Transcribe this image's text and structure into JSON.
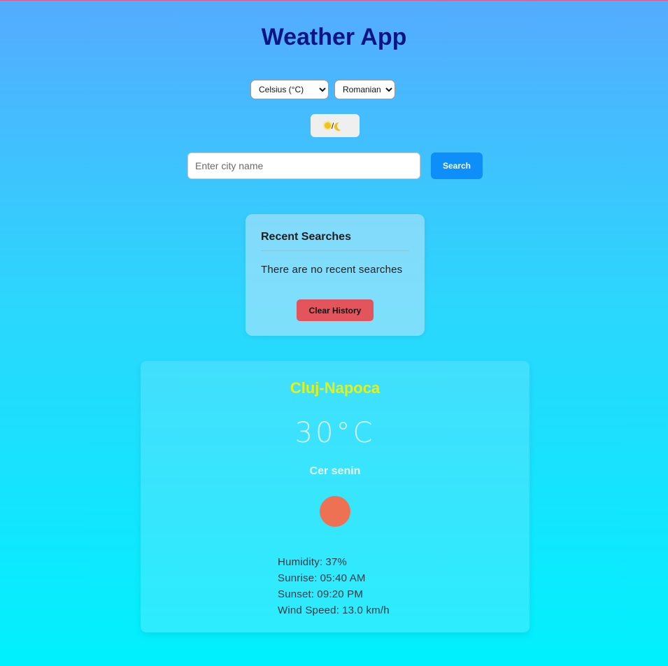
{
  "app": {
    "title": "Weather App"
  },
  "controls": {
    "unit_select": {
      "selected": "Celsius (°C)"
    },
    "language_select": {
      "selected": "Romanian"
    },
    "theme_toggle": {
      "separator": "/",
      "icons": [
        "sun-icon",
        "moon-icon"
      ]
    }
  },
  "search": {
    "placeholder": "Enter city name",
    "value": "",
    "button_label": "Search"
  },
  "recent_searches": {
    "title": "Recent Searches",
    "empty_message": "There are no recent searches",
    "clear_button_label": "Clear History"
  },
  "weather": {
    "city": "Cluj-Napoca",
    "temperature": "30°C",
    "description": "Cer senin",
    "icon": "weather-condition-icon",
    "details": [
      {
        "label": "Humidity:",
        "value": "37%"
      },
      {
        "label": "Sunrise:",
        "value": "05:40 AM"
      },
      {
        "label": "Sunset:",
        "value": "09:20 PM"
      },
      {
        "label": "Wind Speed:",
        "value": "13.0 km/h"
      }
    ]
  },
  "colors": {
    "title": "#0d1585",
    "city": "#e8f10a",
    "search_button": "#0d8ef8",
    "clear_button": "#e3545c",
    "weather_icon": "#ee7153"
  }
}
